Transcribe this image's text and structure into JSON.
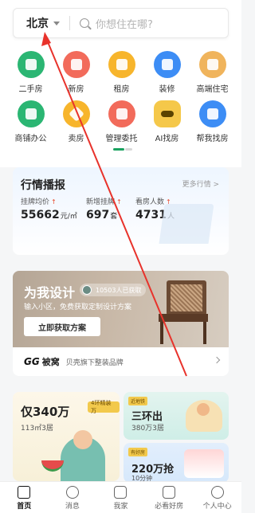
{
  "search": {
    "city": "北京",
    "placeholder": "你想住在哪?"
  },
  "grid": [
    {
      "label": "二手房",
      "icon": "house-icon",
      "color": "#2bb673"
    },
    {
      "label": "新房",
      "icon": "building-icon",
      "color": "#f26b5b"
    },
    {
      "label": "租房",
      "icon": "key-box-icon",
      "color": "#f7b52c"
    },
    {
      "label": "装修",
      "icon": "paint-brush-icon",
      "color": "#3d8df5"
    },
    {
      "label": "高端住宅",
      "icon": "villa-icon",
      "color": "#f0b45c"
    },
    {
      "label": "商铺办公",
      "icon": "shop-icon",
      "color": "#2bb673"
    },
    {
      "label": "卖房",
      "icon": "diamond-tag-icon",
      "color": "#f7b52c"
    },
    {
      "label": "管理委托",
      "icon": "clipboard-icon",
      "color": "#f26b5b"
    },
    {
      "label": "AI找房",
      "icon": "ai-robot-icon",
      "color": "#f5c84a"
    },
    {
      "label": "帮我找房",
      "icon": "house-search-icon",
      "color": "#3d8df5"
    }
  ],
  "market": {
    "title": "行情播报",
    "more": "更多行情 >",
    "stats": [
      {
        "label": "挂牌均价",
        "value": "55662",
        "unit": "元/㎡"
      },
      {
        "label": "新增挂牌",
        "value": "697",
        "unit": "套"
      },
      {
        "label": "看房人数",
        "value": "4731",
        "unit": "人"
      }
    ]
  },
  "design_banner": {
    "title": "为我设计",
    "quote": "“",
    "count": "10503人已获取",
    "subtitle": "输入小区，免费获取定制设计方案",
    "button": "立即获取方案"
  },
  "brand": {
    "logo_mark": "GG",
    "logo_text": "被窝",
    "subtitle": "贝壳旗下整装品牌"
  },
  "promos": {
    "left": {
      "title": "仅340万",
      "sub": "113㎡3居",
      "tag": "4环精装万"
    },
    "right_top": {
      "tag": "近地铁",
      "title": "三环出",
      "sub": "380万3居"
    },
    "right_bottom": {
      "tag": "有好房",
      "title": "220万抢",
      "sub": "10分钟"
    }
  },
  "tabs": [
    {
      "label": "首页",
      "icon": "home-icon",
      "active": true
    },
    {
      "label": "消息",
      "icon": "chat-bubble-icon",
      "active": false
    },
    {
      "label": "我家",
      "icon": "my-home-icon",
      "active": false
    },
    {
      "label": "必看好房",
      "icon": "featured-house-icon",
      "active": false
    },
    {
      "label": "个人中心",
      "icon": "user-face-icon",
      "active": false
    }
  ],
  "colors": {
    "accent": "#1aa260",
    "annotation": "#e8322b",
    "price_up": "#e94b2f"
  }
}
